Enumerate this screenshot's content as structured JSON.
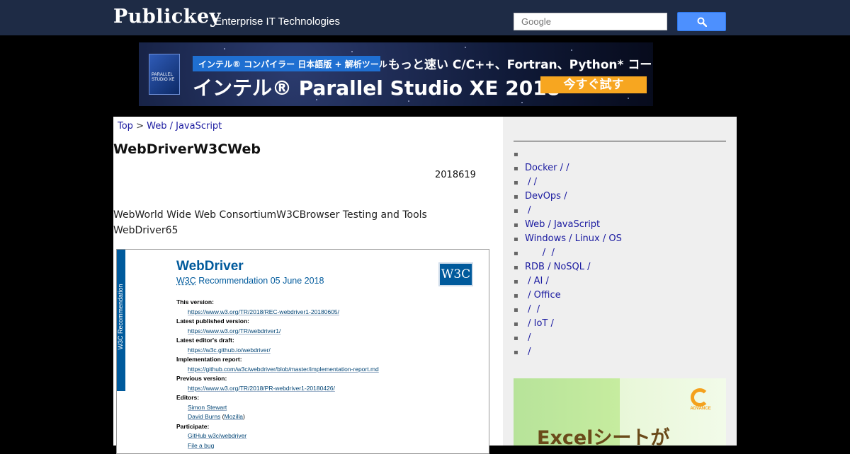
{
  "header": {
    "logo": "Publickey",
    "tagline": "Enterprise IT Technologies",
    "search_placeholder": "Google",
    "search_icon": "magnifier-icon"
  },
  "banner": {
    "box_label": "PARALLEL STUDIO XE",
    "pill": "インテル® コンパイラー 日本語版 + 解析ツール",
    "subtitle": "もっと速い C/C++、Fortran、Python* コードを開発",
    "main": "インテル® Parallel Studio XE 2018",
    "cta": "今すぐ試す"
  },
  "article": {
    "breadcrumb_top": "Top",
    "breadcrumb_sep": ">",
    "breadcrumb_cat": "Web / JavaScript",
    "title": "WebDriverW3CWeb",
    "date": "2018619",
    "body_line1": "WebWorld Wide Web ConsortiumW3CBrowser Testing and Tools",
    "body_line2": "WebDriver65"
  },
  "doc": {
    "stripe": "W3C Recommendation",
    "title": "WebDriver",
    "sub_w3c": "W3C",
    "sub_rest": " Recommendation 05 June 2018",
    "logo": "W3C",
    "fields": [
      {
        "label": "This version:",
        "value": "https://www.w3.org/TR/2018/REC-webdriver1-20180605/"
      },
      {
        "label": "Latest published version:",
        "value": "https://www.w3.org/TR/webdriver1/"
      },
      {
        "label": "Latest editor's draft:",
        "value": "https://w3c.github.io/webdriver/"
      },
      {
        "label": "Implementation report:",
        "value": "https://github.com/w3c/webdriver/blob/master/implementation-report.md"
      },
      {
        "label": "Previous version:",
        "value": "https://www.w3.org/TR/2018/PR-webdriver1-20180426/"
      }
    ],
    "editors_label": "Editors:",
    "editor1": "Simon Stewart",
    "editor2_name": "David Burns",
    "editor2_org": "Mozilla",
    "participate_label": "Participate:",
    "participate1": "GitHub w3c/webdriver",
    "participate2": "File a bug"
  },
  "sidebar": {
    "categories": [
      "",
      "Docker /  /",
      " /  /",
      "DevOps /",
      " /",
      "Web / JavaScript",
      "Windows / Linux / OS",
      "      /  /",
      "RDB / NoSQL /",
      " / AI /",
      " / Office",
      " /  /",
      " / IoT /",
      " /",
      " /"
    ],
    "bullet": "▪"
  },
  "ad2": {
    "logo_text": "ADVANCE",
    "headline": "Excelシートが"
  }
}
